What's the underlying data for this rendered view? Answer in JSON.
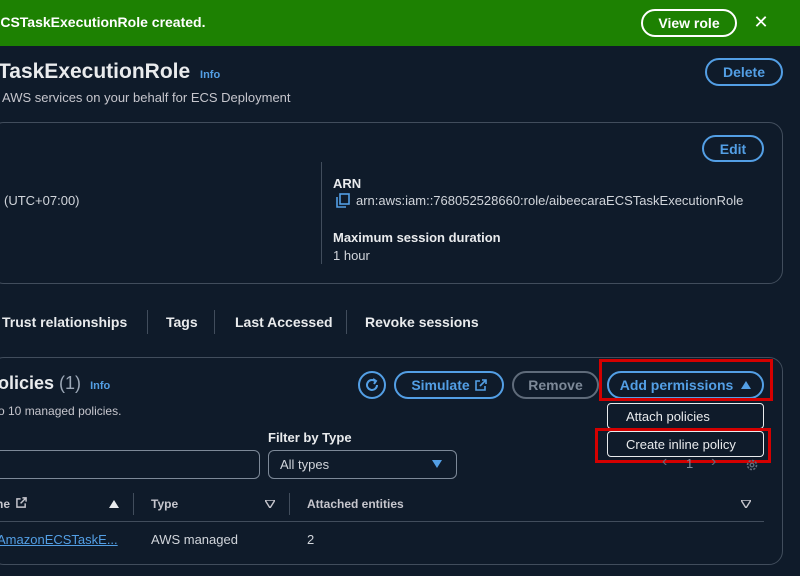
{
  "banner": {
    "message": "ECSTaskExecutionRole created.",
    "view_role_label": "View role",
    "close_glyph": "✕",
    "color": "#1d8102"
  },
  "header": {
    "title": "TaskExecutionRole",
    "info_label": "Info",
    "description": "AWS services on your behalf for ECS Deployment",
    "delete_label": "Delete"
  },
  "summary": {
    "edit_label": "Edit",
    "timezone_value": "(UTC+07:00)",
    "arn_label": "ARN",
    "arn_value": "arn:aws:iam::768052528660:role/aibeecaraECSTaskExecutionRole",
    "max_session_label": "Maximum session duration",
    "max_session_value": "1 hour"
  },
  "tabs": [
    {
      "label": "Trust relationships"
    },
    {
      "label": "Tags"
    },
    {
      "label": "Last Accessed"
    },
    {
      "label": "Revoke sessions"
    }
  ],
  "permissions": {
    "title": "olicies",
    "count": "(1)",
    "info_label": "Info",
    "subtitle": "o 10 managed policies.",
    "simulate_label": "Simulate",
    "remove_label": "Remove",
    "add_permissions_label": "Add permissions",
    "menu": [
      {
        "label": "Attach policies"
      },
      {
        "label": "Create inline policy"
      }
    ],
    "filter_label": "Filter by Type",
    "filter_value": "All types",
    "page_number": "1",
    "prev_glyph": "‹",
    "next_glyph": "›",
    "columns": [
      "ne",
      "Type",
      "Attached entities"
    ],
    "rows": [
      {
        "name": "AmazonECSTaskE...",
        "type": "AWS managed",
        "attached": "2"
      }
    ]
  },
  "colors": {
    "background": "#0f1b2a",
    "accent": "#539fe5",
    "highlight": "#d40000"
  }
}
